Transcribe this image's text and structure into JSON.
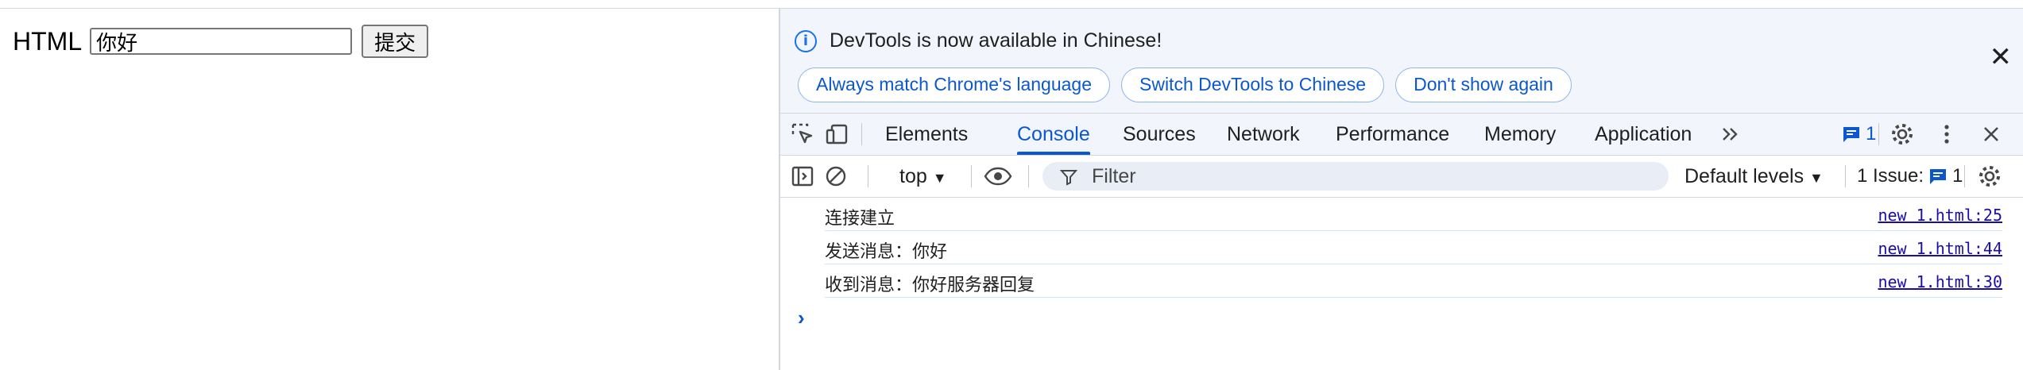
{
  "page": {
    "label": "HTML",
    "input_value": "你好",
    "submit_label": "提交"
  },
  "devtools": {
    "infobar": {
      "message": "DevTools is now available in Chinese!",
      "buttons": [
        "Always match Chrome's language",
        "Switch DevTools to Chinese",
        "Don't show again"
      ]
    },
    "tabs": [
      "Elements",
      "Console",
      "Sources",
      "Network",
      "Performance",
      "Memory",
      "Application"
    ],
    "active_tab": "Console",
    "issues_badge_count": "1",
    "toolbar": {
      "context": "top",
      "filter_placeholder": "Filter",
      "levels": "Default levels",
      "issues_label": "1 Issue:",
      "issues_count": "1"
    },
    "logs": [
      {
        "text": "连接建立",
        "source": "new 1.html:25"
      },
      {
        "text": "发送消息：你好",
        "source": "new 1.html:44"
      },
      {
        "text": "收到消息：你好服务器回复",
        "source": "new 1.html:30"
      }
    ]
  },
  "colors": {
    "accent": "#0b57d0",
    "infobar_bg": "#f2f6fc"
  }
}
